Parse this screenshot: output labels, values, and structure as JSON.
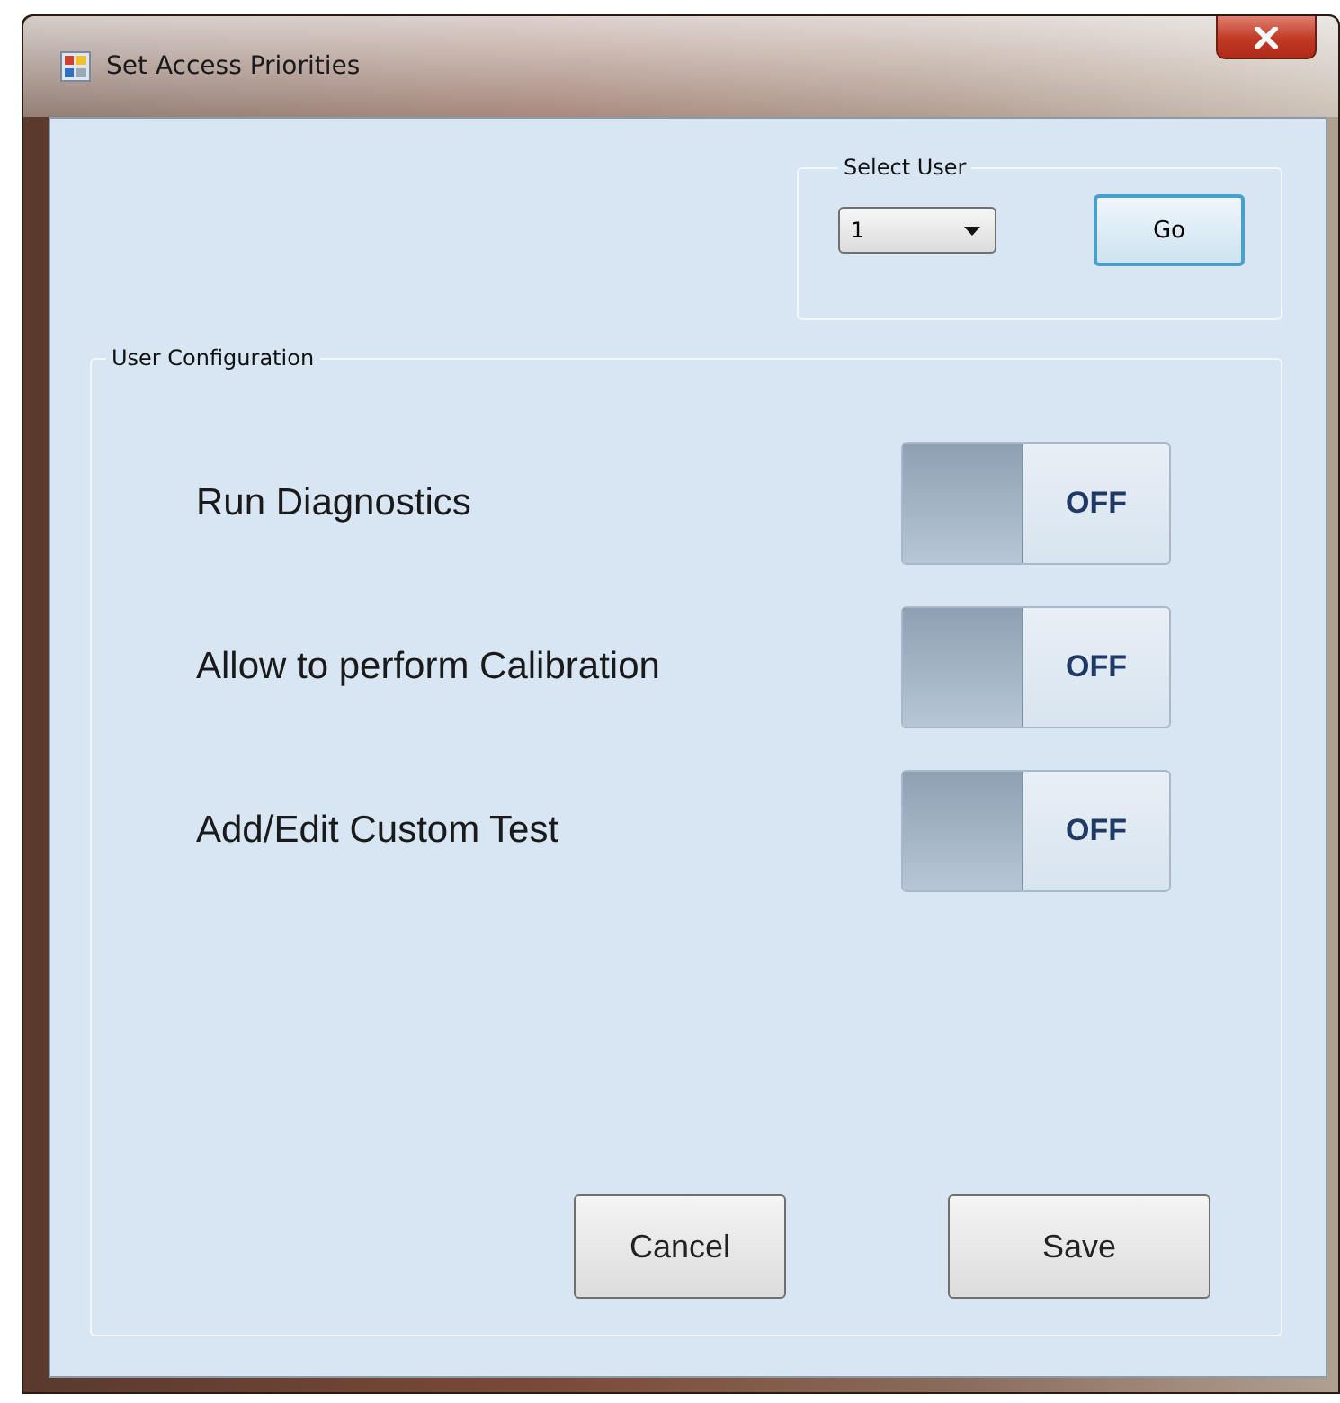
{
  "window": {
    "title": "Set Access Priorities"
  },
  "select_user": {
    "legend": "Select User",
    "dropdown": {
      "value": "1"
    },
    "go_button": "Go"
  },
  "user_configuration": {
    "legend": "User Configuration",
    "settings": [
      {
        "label": "Run Diagnostics",
        "on": false,
        "toggle_text": "OFF"
      },
      {
        "label": "Allow to perform Calibration",
        "on": false,
        "toggle_text": "OFF"
      },
      {
        "label": "Add/Edit Custom Test",
        "on": false,
        "toggle_text": "OFF"
      }
    ],
    "buttons": [
      "Cancel",
      "Save"
    ]
  }
}
